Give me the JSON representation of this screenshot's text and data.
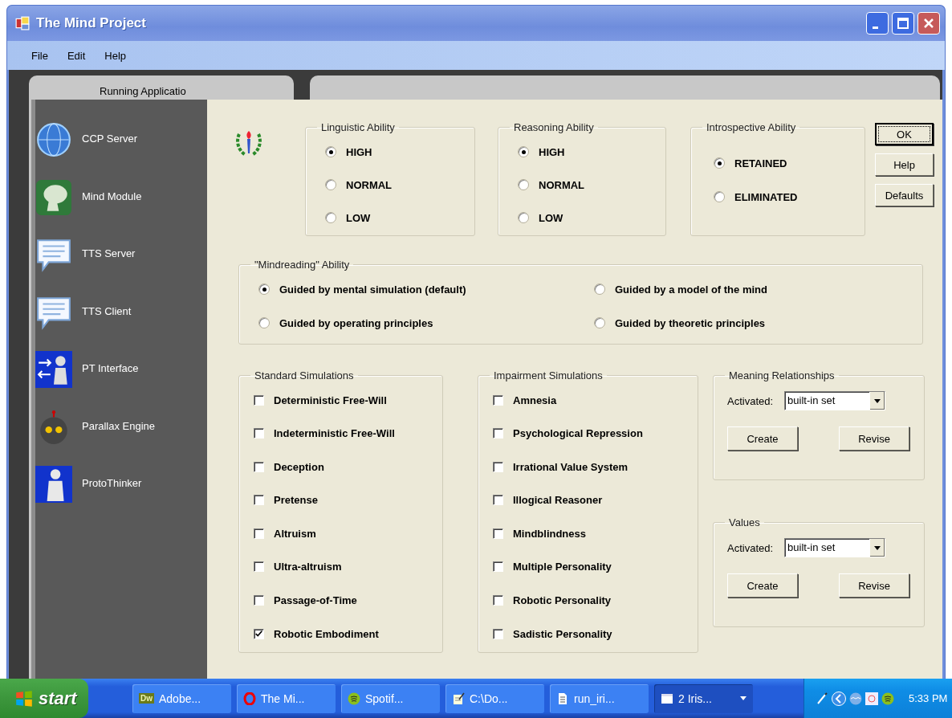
{
  "window": {
    "title": "The Mind Project"
  },
  "menu": [
    "File",
    "Edit",
    "Help"
  ],
  "running_panel": {
    "title": "Running Applicatio",
    "items": [
      "CCP Server",
      "Mind Module",
      "TTS Server",
      "TTS Client",
      "PT Interface",
      "Parallax Engine",
      "ProtoThinker"
    ]
  },
  "dialog": {
    "ability_groups": [
      {
        "title": "Linguistic Ability",
        "options": [
          {
            "label": "HIGH",
            "selected": true
          },
          {
            "label": "NORMAL",
            "selected": false
          },
          {
            "label": "LOW",
            "selected": false
          }
        ]
      },
      {
        "title": "Reasoning Ability",
        "options": [
          {
            "label": "HIGH",
            "selected": true
          },
          {
            "label": "NORMAL",
            "selected": false
          },
          {
            "label": "LOW",
            "selected": false
          }
        ]
      },
      {
        "title": "Introspective Ability",
        "options": [
          {
            "label": "RETAINED",
            "selected": true
          },
          {
            "label": "ELIMINATED",
            "selected": false
          }
        ]
      }
    ],
    "buttons": [
      {
        "label": "OK",
        "focused": true
      },
      {
        "label": "Help",
        "focused": false
      },
      {
        "label": "Defaults",
        "focused": false
      }
    ],
    "mindreading": {
      "title": "\"Mindreading\" Ability",
      "options": [
        {
          "label": "Guided by mental simulation (default)",
          "selected": true
        },
        {
          "label": "Guided by a model of the mind",
          "selected": false
        },
        {
          "label": "Guided by operating principles",
          "selected": false
        },
        {
          "label": "Guided by theoretic principles",
          "selected": false
        }
      ]
    },
    "simulation_groups": [
      {
        "title": "Standard Simulations",
        "items": [
          {
            "label": "Deterministic Free-Will",
            "checked": false
          },
          {
            "label": "Indeterministic Free-Will",
            "checked": false
          },
          {
            "label": "Deception",
            "checked": false
          },
          {
            "label": "Pretense",
            "checked": false
          },
          {
            "label": "Altruism",
            "checked": false
          },
          {
            "label": "Ultra-altruism",
            "checked": false
          },
          {
            "label": "Passage-of-Time",
            "checked": false
          },
          {
            "label": "Robotic Embodiment",
            "checked": true
          }
        ]
      },
      {
        "title": "Impairment Simulations",
        "items": [
          {
            "label": "Amnesia",
            "checked": false
          },
          {
            "label": "Psychological Repression",
            "checked": false
          },
          {
            "label": "Irrational Value System",
            "checked": false
          },
          {
            "label": "Illogical Reasoner",
            "checked": false
          },
          {
            "label": "Mindblindness",
            "checked": false
          },
          {
            "label": "Multiple Personality",
            "checked": false
          },
          {
            "label": "Robotic Personality",
            "checked": false
          },
          {
            "label": "Sadistic Personality",
            "checked": false
          }
        ]
      }
    ],
    "set_groups": [
      {
        "title": "Meaning Relationships",
        "activated_label": "Activated:",
        "value": "built-in set",
        "buttons": [
          "Create",
          "Revise"
        ]
      },
      {
        "title": "Values",
        "activated_label": "Activated:",
        "value": "built-in set",
        "buttons": [
          "Create",
          "Revise"
        ]
      }
    ]
  },
  "taskbar": {
    "start": "start",
    "tasks": [
      {
        "label": "Adobe...",
        "icon_text": "Dw",
        "selected": false
      },
      {
        "label": "The Mi...",
        "selected": false
      },
      {
        "label": "Spotif...",
        "selected": false
      },
      {
        "label": "C:\\Do...",
        "selected": false
      },
      {
        "label": "run_iri...",
        "selected": false
      },
      {
        "label": "2 Iris...",
        "selected": true
      }
    ],
    "clock": "5:33 PM"
  }
}
